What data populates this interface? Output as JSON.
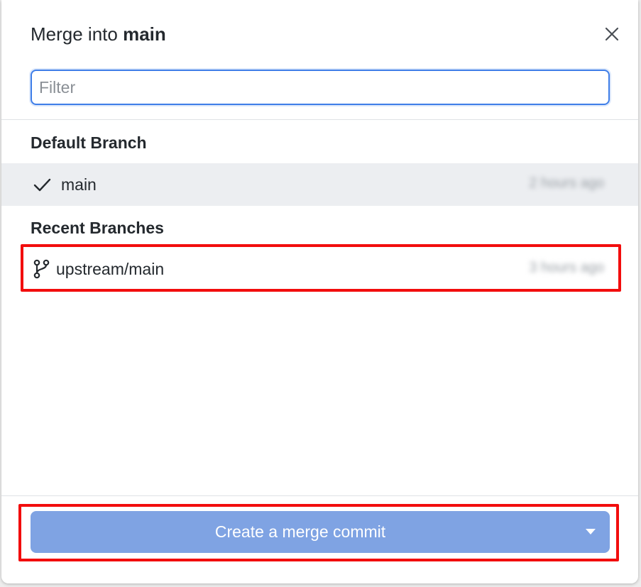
{
  "dialog": {
    "title_prefix": "Merge into",
    "title_branch": "main",
    "close_icon": "close-icon"
  },
  "filter": {
    "placeholder": "Filter",
    "value": ""
  },
  "sections": {
    "default": {
      "header": "Default Branch",
      "items": [
        {
          "name": "main",
          "time": "2 hours ago",
          "icon": "check-icon",
          "selected": true
        }
      ]
    },
    "recent": {
      "header": "Recent Branches",
      "items": [
        {
          "name": "upstream/main",
          "time": "3 hours ago",
          "icon": "git-branch-icon",
          "selected": false
        }
      ]
    }
  },
  "footer": {
    "merge_button_label": "Create a merge commit",
    "dropdown_icon": "caret-down-icon"
  },
  "colors": {
    "accent": "#3f7ee8",
    "merge_button_bg": "#7fa3e3",
    "selected_row_bg": "#eceef1",
    "highlight_border": "#f20d0d"
  }
}
